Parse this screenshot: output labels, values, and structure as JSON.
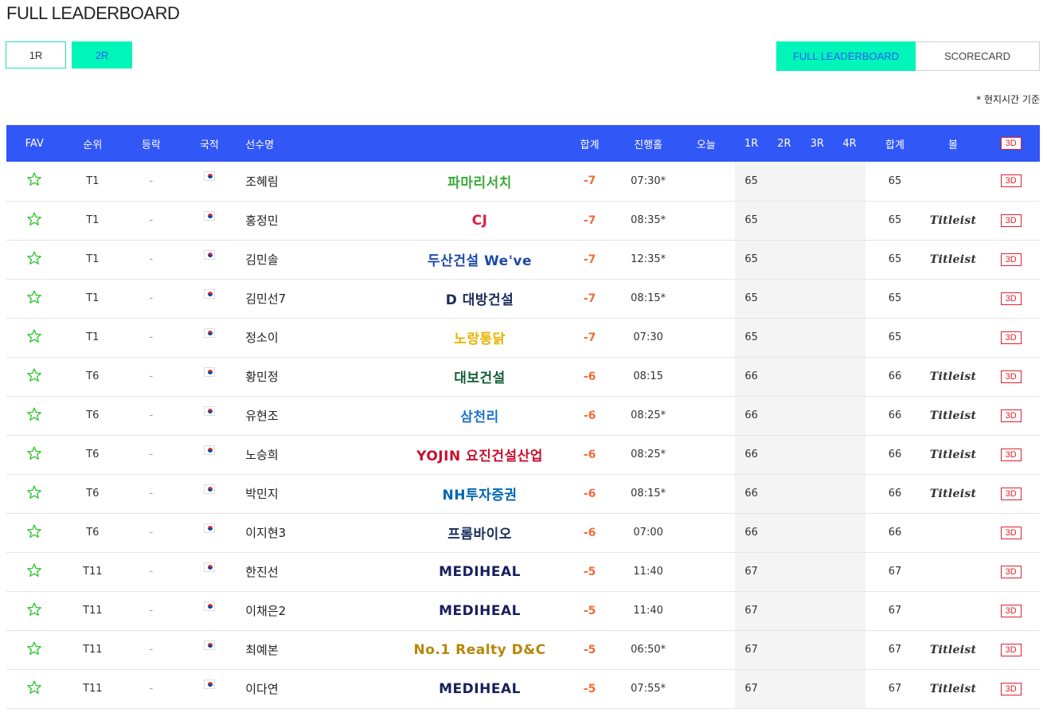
{
  "page": {
    "title": "FULL LEADERBOARD",
    "time_note": "* 현지시간 기준"
  },
  "round_tabs": [
    {
      "label": "1R",
      "active": false
    },
    {
      "label": "2R",
      "active": true
    }
  ],
  "view_tabs": {
    "full": "FULL LEADERBOARD",
    "scorecard": "SCORECARD"
  },
  "headers": {
    "fav": "FAV",
    "rank": "순위",
    "move": "등락",
    "nation": "국적",
    "name": "선수명",
    "total": "합계",
    "thru": "진행홀",
    "today": "오늘",
    "r1": "1R",
    "r2": "2R",
    "r3": "3R",
    "r4": "4R",
    "sum": "합계",
    "ball": "볼",
    "view3d": "3D"
  },
  "colors": {
    "header_bg": "#3157f6",
    "accent": "#00f5b8",
    "accent_text": "#2f5bff",
    "under_par": "#f26b3a",
    "threed": "#e0212e",
    "star": "#2ec52e"
  },
  "rows": [
    {
      "rank": "T1",
      "move": "-",
      "name": "조혜림",
      "sponsor": "파마리서치",
      "sponsor_color": "#3aa83a",
      "total": "-7",
      "thru": "07:30*",
      "today": "",
      "r1": "65",
      "sum": "65",
      "ball": "",
      "view3d": "3D"
    },
    {
      "rank": "T1",
      "move": "-",
      "name": "홍정민",
      "sponsor": "CJ",
      "sponsor_color": "#e31d3c",
      "total": "-7",
      "thru": "08:35*",
      "today": "",
      "r1": "65",
      "sum": "65",
      "ball": "Titleist",
      "view3d": "3D"
    },
    {
      "rank": "T1",
      "move": "-",
      "name": "김민솔",
      "sponsor": "두산건설 We've",
      "sponsor_color": "#1e4ba8",
      "total": "-7",
      "thru": "12:35*",
      "today": "",
      "r1": "65",
      "sum": "65",
      "ball": "Titleist",
      "view3d": "3D"
    },
    {
      "rank": "T1",
      "move": "-",
      "name": "김민선7",
      "sponsor": "D 대방건설",
      "sponsor_color": "#1c2a5a",
      "total": "-7",
      "thru": "08:15*",
      "today": "",
      "r1": "65",
      "sum": "65",
      "ball": "",
      "view3d": "3D"
    },
    {
      "rank": "T1",
      "move": "-",
      "name": "정소이",
      "sponsor": "노랑통닭",
      "sponsor_color": "#e8b400",
      "total": "-7",
      "thru": "07:30",
      "today": "",
      "r1": "65",
      "sum": "65",
      "ball": "",
      "view3d": "3D"
    },
    {
      "rank": "T6",
      "move": "-",
      "name": "황민정",
      "sponsor": "대보건설",
      "sponsor_color": "#14603a",
      "total": "-6",
      "thru": "08:15",
      "today": "",
      "r1": "66",
      "sum": "66",
      "ball": "Titleist",
      "view3d": "3D"
    },
    {
      "rank": "T6",
      "move": "-",
      "name": "유현조",
      "sponsor": "삼천리",
      "sponsor_color": "#1b73c9",
      "total": "-6",
      "thru": "08:25*",
      "today": "",
      "r1": "66",
      "sum": "66",
      "ball": "Titleist",
      "view3d": "3D"
    },
    {
      "rank": "T6",
      "move": "-",
      "name": "노승희",
      "sponsor": "YOJIN 요진건설산업",
      "sponsor_color": "#c8102e",
      "total": "-6",
      "thru": "08:25*",
      "today": "",
      "r1": "66",
      "sum": "66",
      "ball": "Titleist",
      "view3d": "3D"
    },
    {
      "rank": "T6",
      "move": "-",
      "name": "박민지",
      "sponsor": "NH투자증권",
      "sponsor_color": "#0067b1",
      "total": "-6",
      "thru": "08:15*",
      "today": "",
      "r1": "66",
      "sum": "66",
      "ball": "Titleist",
      "view3d": "3D"
    },
    {
      "rank": "T6",
      "move": "-",
      "name": "이지현3",
      "sponsor": "프롬바이오",
      "sponsor_color": "#1a2f5a",
      "total": "-6",
      "thru": "07:00",
      "today": "",
      "r1": "66",
      "sum": "66",
      "ball": "",
      "view3d": "3D"
    },
    {
      "rank": "T11",
      "move": "-",
      "name": "한진선",
      "sponsor": "MEDIHEAL",
      "sponsor_color": "#1a1f5c",
      "total": "-5",
      "thru": "11:40",
      "today": "",
      "r1": "67",
      "sum": "67",
      "ball": "",
      "view3d": "3D"
    },
    {
      "rank": "T11",
      "move": "-",
      "name": "이채은2",
      "sponsor": "MEDIHEAL",
      "sponsor_color": "#1a1f5c",
      "total": "-5",
      "thru": "11:40",
      "today": "",
      "r1": "67",
      "sum": "67",
      "ball": "",
      "view3d": "3D"
    },
    {
      "rank": "T11",
      "move": "-",
      "name": "최예본",
      "sponsor": "No.1 Realty D&C",
      "sponsor_color": "#b8860b",
      "total": "-5",
      "thru": "06:50*",
      "today": "",
      "r1": "67",
      "sum": "67",
      "ball": "Titleist",
      "view3d": "3D"
    },
    {
      "rank": "T11",
      "move": "-",
      "name": "이다연",
      "sponsor": "MEDIHEAL",
      "sponsor_color": "#1a1f5c",
      "total": "-5",
      "thru": "07:55*",
      "today": "",
      "r1": "67",
      "sum": "67",
      "ball": "Titleist",
      "view3d": "3D"
    }
  ]
}
